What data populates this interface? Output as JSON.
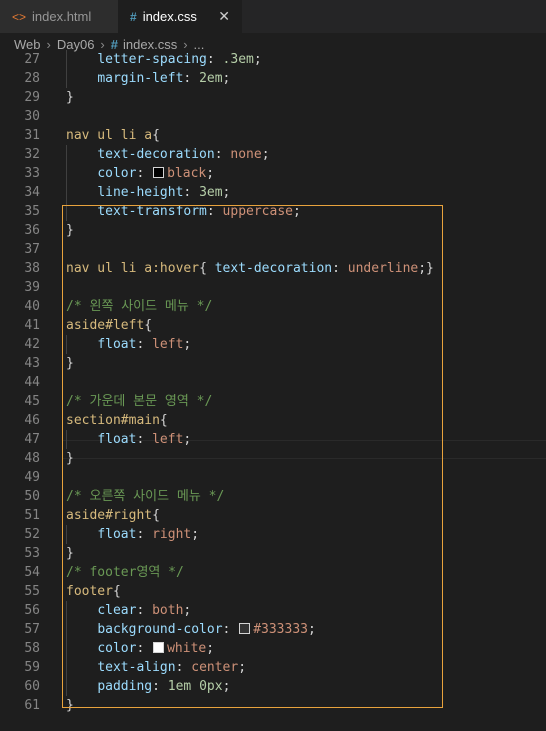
{
  "tabs": [
    {
      "icon": "html-file-icon",
      "label": "index.html",
      "active": false
    },
    {
      "icon": "css-file-icon",
      "label": "index.css",
      "active": true,
      "close": "✕"
    }
  ],
  "breadcrumb": {
    "items": [
      "Web",
      "Day06",
      "index.css",
      "..."
    ]
  },
  "colors": {
    "selection_border": "#e8a33d",
    "selector": "#d7ba7d",
    "property": "#9cdcfe",
    "value": "#ce9178",
    "comment": "#6a9955",
    "line_number": "#858585"
  },
  "lines": [
    {
      "n": "27",
      "code": [
        [
          "    ",
          "p"
        ],
        [
          "letter-spacing",
          "prop"
        ],
        [
          ": ",
          "p"
        ],
        [
          ".3em",
          "num"
        ],
        [
          ";",
          "p"
        ]
      ]
    },
    {
      "n": "28",
      "code": [
        [
          "    ",
          "p"
        ],
        [
          "margin-left",
          "prop"
        ],
        [
          ": ",
          "p"
        ],
        [
          "2em",
          "num"
        ],
        [
          ";",
          "p"
        ]
      ]
    },
    {
      "n": "29",
      "code": [
        [
          "}",
          "p"
        ]
      ]
    },
    {
      "n": "30",
      "code": []
    },
    {
      "n": "31",
      "code": [
        [
          "nav ul li a",
          "sel"
        ],
        [
          "{",
          "p"
        ]
      ]
    },
    {
      "n": "32",
      "code": [
        [
          "    ",
          "p"
        ],
        [
          "text-decoration",
          "prop"
        ],
        [
          ": ",
          "p"
        ],
        [
          "none",
          "val"
        ],
        [
          ";",
          "p"
        ]
      ]
    },
    {
      "n": "33",
      "code": [
        [
          "    ",
          "p"
        ],
        [
          "color",
          "prop"
        ],
        [
          ": ",
          "p"
        ],
        [
          "#000000",
          "swatch"
        ],
        [
          "black",
          "val"
        ],
        [
          ";",
          "p"
        ]
      ]
    },
    {
      "n": "34",
      "code": [
        [
          "    ",
          "p"
        ],
        [
          "line-height",
          "prop"
        ],
        [
          ": ",
          "p"
        ],
        [
          "3em",
          "num"
        ],
        [
          ";",
          "p"
        ]
      ]
    },
    {
      "n": "35",
      "code": [
        [
          "    ",
          "p"
        ],
        [
          "text-transform",
          "prop"
        ],
        [
          ": ",
          "p"
        ],
        [
          "uppercase",
          "val"
        ],
        [
          ";",
          "p"
        ]
      ]
    },
    {
      "n": "36",
      "code": [
        [
          "}",
          "p"
        ]
      ]
    },
    {
      "n": "37",
      "code": []
    },
    {
      "n": "38",
      "code": [
        [
          "nav ul li a:hover",
          "sel"
        ],
        [
          "{ ",
          "p"
        ],
        [
          "text-decoration",
          "prop"
        ],
        [
          ": ",
          "p"
        ],
        [
          "underline",
          "val"
        ],
        [
          ";}",
          "p"
        ]
      ]
    },
    {
      "n": "39",
      "code": []
    },
    {
      "n": "40",
      "code": [
        [
          "/* 왼쪽 사이드 메뉴 */",
          "com"
        ]
      ]
    },
    {
      "n": "41",
      "code": [
        [
          "aside#left",
          "sel"
        ],
        [
          "{",
          "p"
        ]
      ]
    },
    {
      "n": "42",
      "code": [
        [
          "    ",
          "p"
        ],
        [
          "float",
          "prop"
        ],
        [
          ": ",
          "p"
        ],
        [
          "left",
          "val"
        ],
        [
          ";",
          "p"
        ]
      ]
    },
    {
      "n": "43",
      "code": [
        [
          "}",
          "p"
        ]
      ]
    },
    {
      "n": "44",
      "code": []
    },
    {
      "n": "45",
      "code": [
        [
          "/* 가운데 본문 영역 */",
          "com"
        ]
      ]
    },
    {
      "n": "46",
      "code": [
        [
          "section#main",
          "sel"
        ],
        [
          "{",
          "p"
        ]
      ]
    },
    {
      "n": "47",
      "code": [
        [
          "    ",
          "p"
        ],
        [
          "float",
          "prop"
        ],
        [
          ": ",
          "p"
        ],
        [
          "left",
          "val"
        ],
        [
          ";",
          "p"
        ]
      ]
    },
    {
      "n": "48",
      "code": [
        [
          "}",
          "p"
        ]
      ]
    },
    {
      "n": "49",
      "code": []
    },
    {
      "n": "50",
      "code": [
        [
          "/* 오른쪽 사이드 메뉴 */",
          "com"
        ]
      ]
    },
    {
      "n": "51",
      "code": [
        [
          "aside#right",
          "sel"
        ],
        [
          "{",
          "p"
        ]
      ]
    },
    {
      "n": "52",
      "code": [
        [
          "    ",
          "p"
        ],
        [
          "float",
          "prop"
        ],
        [
          ": ",
          "p"
        ],
        [
          "right",
          "val"
        ],
        [
          ";",
          "p"
        ]
      ]
    },
    {
      "n": "53",
      "code": [
        [
          "}",
          "p"
        ]
      ]
    },
    {
      "n": "54",
      "code": [
        [
          "/* footer영역 */",
          "com"
        ]
      ]
    },
    {
      "n": "55",
      "code": [
        [
          "footer",
          "sel"
        ],
        [
          "{",
          "p"
        ]
      ]
    },
    {
      "n": "56",
      "code": [
        [
          "    ",
          "p"
        ],
        [
          "clear",
          "prop"
        ],
        [
          ": ",
          "p"
        ],
        [
          "both",
          "val"
        ],
        [
          ";",
          "p"
        ]
      ]
    },
    {
      "n": "57",
      "code": [
        [
          "    ",
          "p"
        ],
        [
          "background-color",
          "prop"
        ],
        [
          ": ",
          "p"
        ],
        [
          "#333333",
          "swatch"
        ],
        [
          "#333333",
          "val"
        ],
        [
          ";",
          "p"
        ]
      ]
    },
    {
      "n": "58",
      "code": [
        [
          "    ",
          "p"
        ],
        [
          "color",
          "prop"
        ],
        [
          ": ",
          "p"
        ],
        [
          "#ffffff",
          "swatch"
        ],
        [
          "white",
          "val"
        ],
        [
          ";",
          "p"
        ]
      ]
    },
    {
      "n": "59",
      "code": [
        [
          "    ",
          "p"
        ],
        [
          "text-align",
          "prop"
        ],
        [
          ": ",
          "p"
        ],
        [
          "center",
          "val"
        ],
        [
          ";",
          "p"
        ]
      ]
    },
    {
      "n": "60",
      "code": [
        [
          "    ",
          "p"
        ],
        [
          "padding",
          "prop"
        ],
        [
          ": ",
          "p"
        ],
        [
          "1em 0px",
          "num"
        ],
        [
          ";",
          "p"
        ]
      ]
    },
    {
      "n": "61",
      "code": [
        [
          "}",
          "p"
        ]
      ]
    }
  ]
}
